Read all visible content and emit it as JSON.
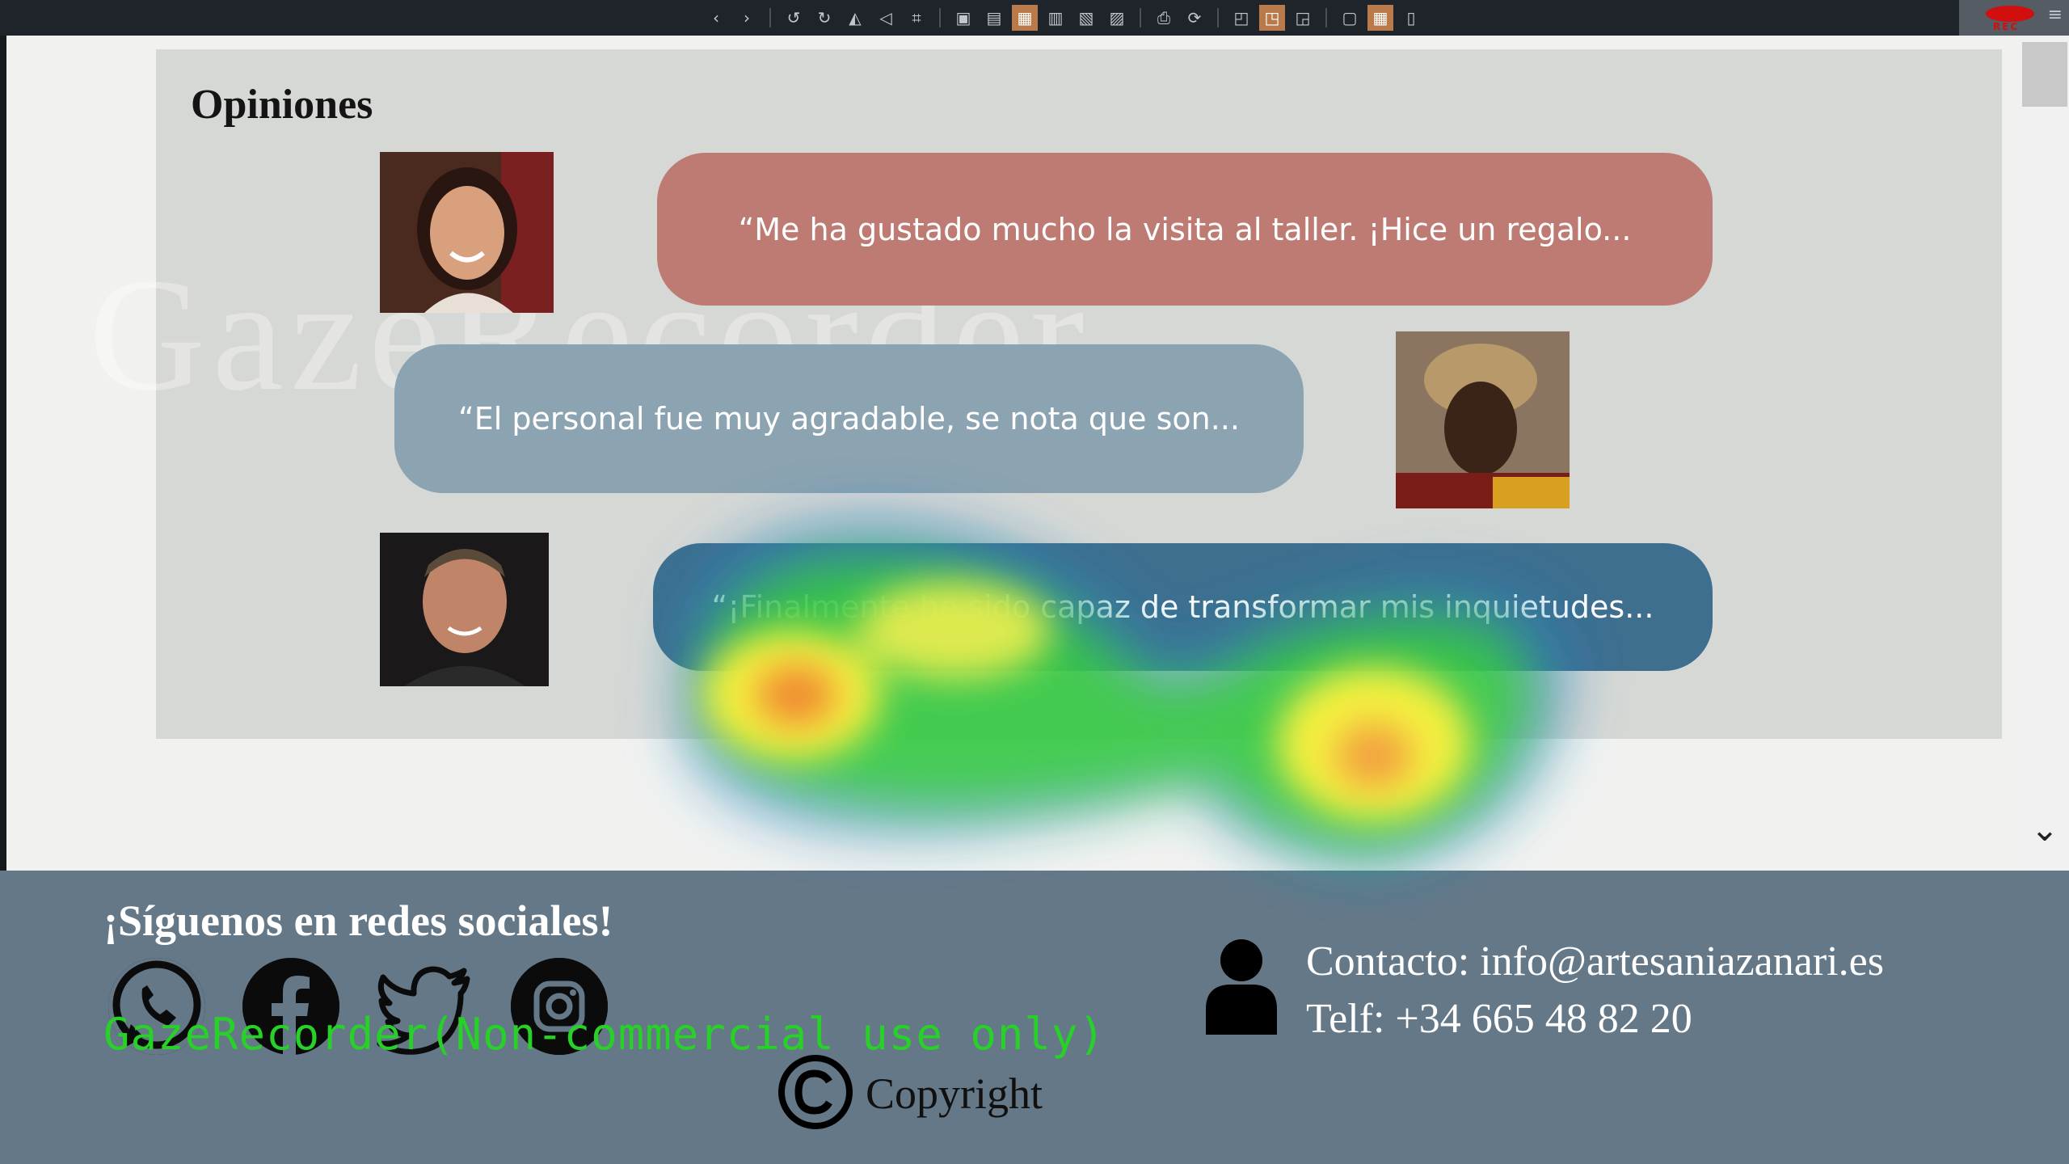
{
  "toolbar": {
    "icons": [
      "chevron-left-icon",
      "chevron-right-icon",
      "undo-icon",
      "redo-icon",
      "flip-icon",
      "rotate-icon",
      "crop-icon",
      "view-1-icon",
      "view-2-icon",
      "view-3-icon",
      "view-4-icon",
      "view-5-icon",
      "view-6-icon",
      "print-icon",
      "refresh-icon",
      "layout-1-icon",
      "layout-2-icon",
      "layout-3-icon",
      "image-icon",
      "grid-icon",
      "delete-icon"
    ],
    "active_icons": [
      "view-3-icon",
      "layout-2-icon",
      "grid-icon"
    ]
  },
  "recorder": {
    "label": "REC"
  },
  "watermark": {
    "overlay": "GazeRecorder",
    "footer": "GazeRecorder(Non-commercial use only)"
  },
  "opinions": {
    "title": "Opiniones",
    "items": [
      {
        "text": "“Me ha gustado mucho la visita al taller. ¡Hice un regalo...",
        "color": "#bd7b73"
      },
      {
        "text": "“El personal fue muy agradable, se nota que son...",
        "color": "#8ca3b1"
      },
      {
        "text": "“¡Finalmente he sido capaz de transformar mis inquietudes...",
        "color": "#3e6f8f"
      }
    ]
  },
  "footer": {
    "title": "¡Síguenos en redes sociales!",
    "social": [
      "whatsapp-icon",
      "facebook-icon",
      "twitter-icon",
      "instagram-icon"
    ],
    "contact": {
      "email_line": "Contacto: info@artesaniazanari.es",
      "phone_line": "Telf: +34 665 48 82 20"
    },
    "copyright": "Copyright"
  },
  "colors": {
    "toolbar_bg": "#1e242a",
    "opinions_bg": "#d6d8d5",
    "footer_bg": "#647888",
    "active_toolbar": "#b87a4a",
    "watermark_green": "#27d127"
  }
}
